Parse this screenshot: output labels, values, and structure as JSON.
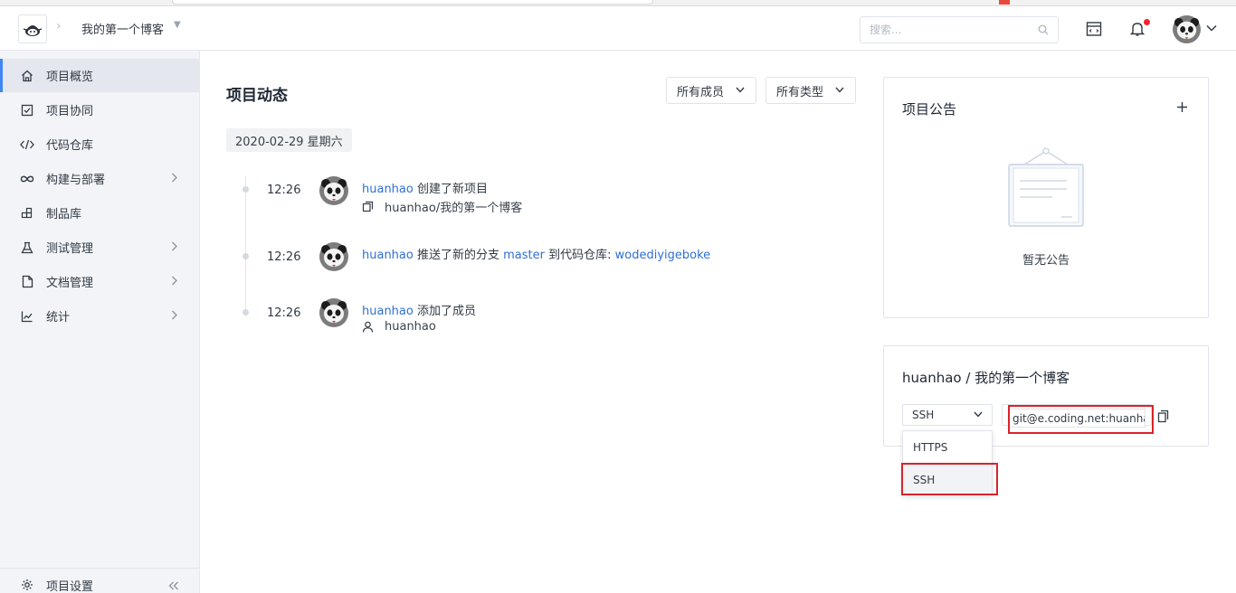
{
  "header": {
    "project_name": "我的第一个博客",
    "search_placeholder": "搜索..."
  },
  "sidebar": {
    "items": [
      {
        "label": "项目概览",
        "icon": "home-icon",
        "active": true
      },
      {
        "label": "项目协同",
        "icon": "checkbox-icon"
      },
      {
        "label": "代码仓库",
        "icon": "code-icon"
      },
      {
        "label": "构建与部署",
        "icon": "infinity-icon",
        "expandable": true
      },
      {
        "label": "制品库",
        "icon": "artifact-icon"
      },
      {
        "label": "测试管理",
        "icon": "flask-icon",
        "expandable": true
      },
      {
        "label": "文档管理",
        "icon": "document-icon",
        "expandable": true
      },
      {
        "label": "统计",
        "icon": "chart-icon",
        "expandable": true
      }
    ],
    "settings_label": "项目设置"
  },
  "activity": {
    "title": "项目动态",
    "filter_members": "所有成员",
    "filter_types": "所有类型",
    "date": "2020-02-29 星期六",
    "events": [
      {
        "time": "12:26",
        "user": "huanhao",
        "action": "创建了新项目",
        "sub_text": "huanhao/我的第一个博客",
        "sub_icon": "copy-icon"
      },
      {
        "time": "12:26",
        "user": "huanhao",
        "action": "推送了新的分支",
        "branch": "master",
        "action2": "到代码仓库:",
        "repo": "wodediyigeboke"
      },
      {
        "time": "12:26",
        "user": "huanhao",
        "action": "添加了成员",
        "sub_text": "huanhao",
        "sub_icon": "user-icon"
      }
    ]
  },
  "announcement": {
    "title": "项目公告",
    "empty": "暂无公告"
  },
  "repo": {
    "title": "huanhao / 我的第一个博客",
    "protocol": "SSH",
    "url": "git@e.coding.net:huanhao/wodediyigeboke.git",
    "dropdown_options": [
      "HTTPS",
      "SSH"
    ]
  },
  "colors": {
    "accent": "#3e86f5",
    "link": "#2f6fd6",
    "highlight": "#d9232a"
  }
}
